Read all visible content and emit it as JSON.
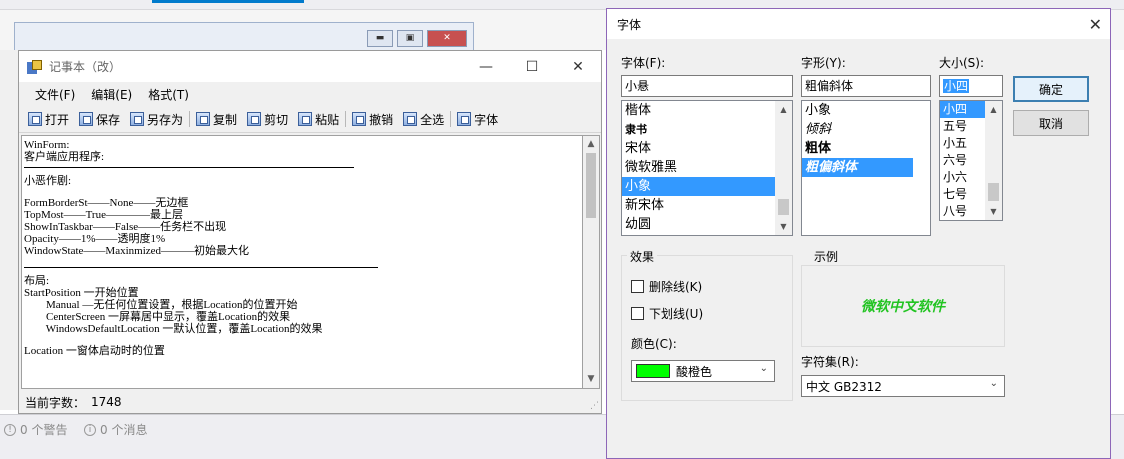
{
  "ide": {
    "status_warnings": "0 个警告",
    "status_messages": "0 个消息"
  },
  "notepad": {
    "title": "记事本（改）",
    "window_controls": [
      "—",
      "☐",
      "✕"
    ],
    "menu": [
      "文件(F)",
      "编辑(E)",
      "格式(T)"
    ],
    "toolbar": [
      "打开",
      "保存",
      "另存为",
      "复制",
      "剪切",
      "粘贴",
      "撤销",
      "全选",
      "字体"
    ],
    "text_lines": [
      "WinForm:",
      "客户端应用程序:",
      "小恶作剧:",
      "FormBorderSt——None——无边框",
      "TopMost——True————最上层",
      "ShowInTaskbar——False——任务栏不出现",
      "Opacity——1%——透明度1%",
      "WindowState——Maxinmized———初始最大化",
      "布局:",
      "StartPosition 一开始位置",
      "        Manual —无任何位置设置，根据Location的位置开始",
      "        CenterScreen 一屏幕居中显示，覆盖Location的效果",
      "        WindowsDefaultLocation 一默认位置，覆盖Location的效果",
      "Location 一窗体启动时的位置"
    ],
    "status_label": "当前字数：",
    "status_count": "1748"
  },
  "font_dialog": {
    "title": "字体",
    "font_label": "字体(F):",
    "font_value": "小悬",
    "font_list": [
      "楷体",
      "隶书",
      "宋体",
      "微软雅黑",
      "小象",
      "新宋体",
      "幼圆"
    ],
    "font_selected_index": 4,
    "style_label": "字形(Y):",
    "style_value": "粗偏斜体",
    "style_list": [
      "小象",
      "倾斜",
      "粗体",
      "粗偏斜体"
    ],
    "style_selected_index": 3,
    "size_label": "大小(S):",
    "size_value": "小四",
    "size_list": [
      "小四",
      "五号",
      "小五",
      "六号",
      "小六",
      "七号",
      "八号"
    ],
    "size_selected_index": 0,
    "ok_button": "确定",
    "cancel_button": "取消",
    "effects_label": "效果",
    "strikeout_label": "删除线(K)",
    "strikeout_checked": false,
    "underline_label": "下划线(U)",
    "underline_checked": false,
    "color_label": "颜色(C):",
    "color_value": "酸橙色",
    "color_hex": "#00ff00",
    "sample_label": "示例",
    "sample_text": "微软中文软件",
    "charset_label": "字符集(R):",
    "charset_value": "中文 GB2312"
  }
}
